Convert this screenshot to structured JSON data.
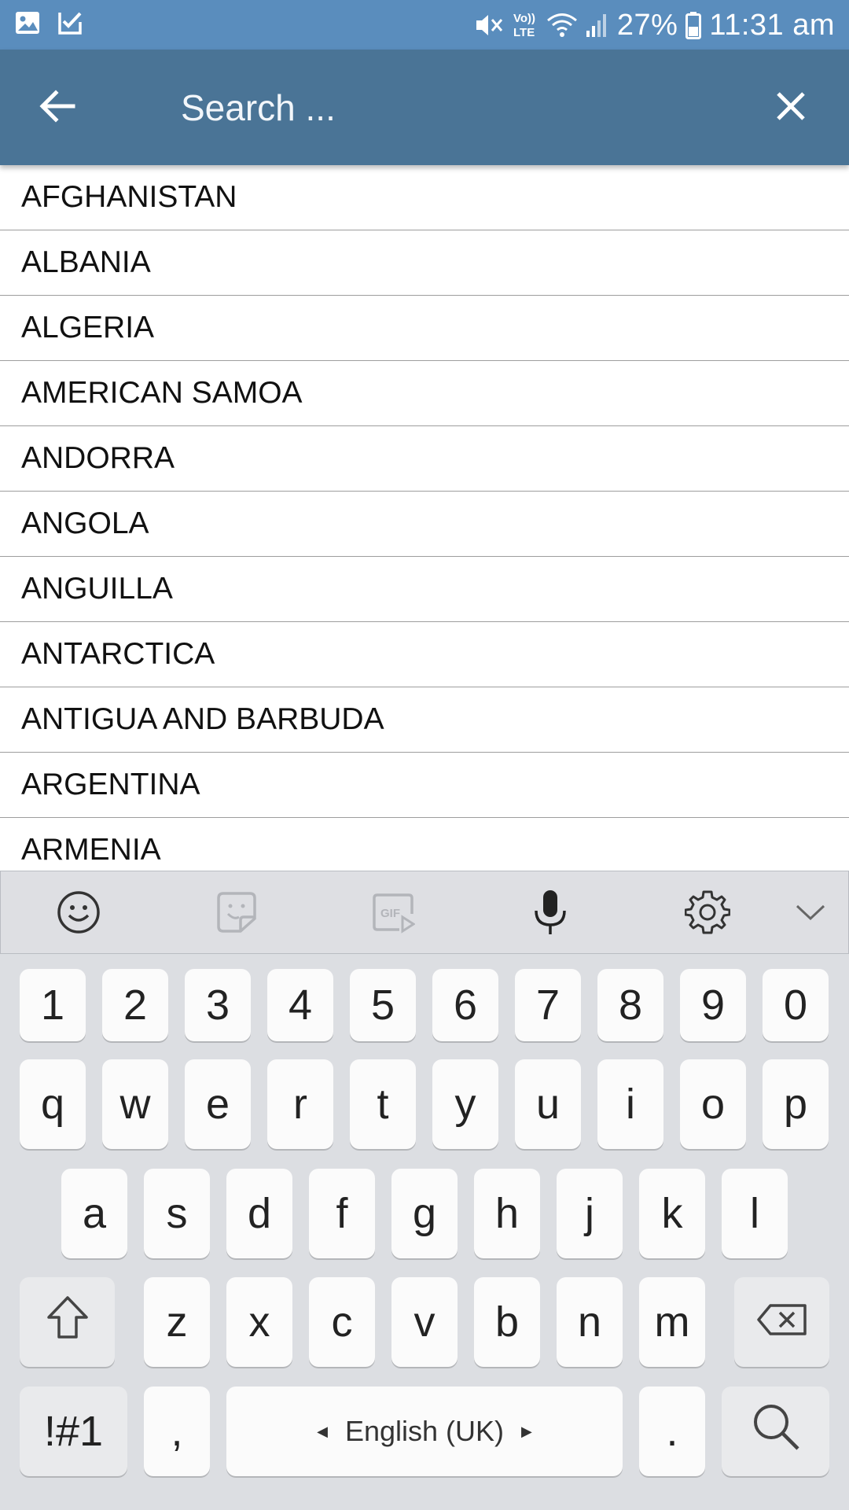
{
  "status_bar": {
    "battery_percent": "27%",
    "time": "11:31 am",
    "left_icons": [
      "gallery-icon",
      "task-check-icon"
    ],
    "right_icons": [
      "mute-icon",
      "volte-icon",
      "wifi-icon",
      "signal-icon",
      "battery-icon"
    ],
    "volte_label": "Vo))\nLTE"
  },
  "app_bar": {
    "search_placeholder": "Search ...",
    "search_value": "",
    "background_color": "#4a7496"
  },
  "countries": [
    "AFGHANISTAN",
    "ALBANIA",
    "ALGERIA",
    "AMERICAN SAMOA",
    "ANDORRA",
    "ANGOLA",
    "ANGUILLA",
    "ANTARCTICA",
    "ANTIGUA AND BARBUDA",
    "ARGENTINA",
    "ARMENIA"
  ],
  "keyboard": {
    "toolbar": [
      "emoji-icon",
      "sticker-icon",
      "gif-icon",
      "microphone-icon",
      "settings-icon",
      "chevron-down-icon"
    ],
    "gif_label": "GIF",
    "row_numbers": [
      "1",
      "2",
      "3",
      "4",
      "5",
      "6",
      "7",
      "8",
      "9",
      "0"
    ],
    "row_q": [
      "q",
      "w",
      "e",
      "r",
      "t",
      "y",
      "u",
      "i",
      "o",
      "p"
    ],
    "row_a": [
      "a",
      "s",
      "d",
      "f",
      "g",
      "h",
      "j",
      "k",
      "l"
    ],
    "row_z": [
      "z",
      "x",
      "c",
      "v",
      "b",
      "n",
      "m"
    ],
    "symbols_label": "!#1",
    "comma_label": ",",
    "space_label": "English (UK)",
    "period_label": ".",
    "action": "search-icon"
  }
}
